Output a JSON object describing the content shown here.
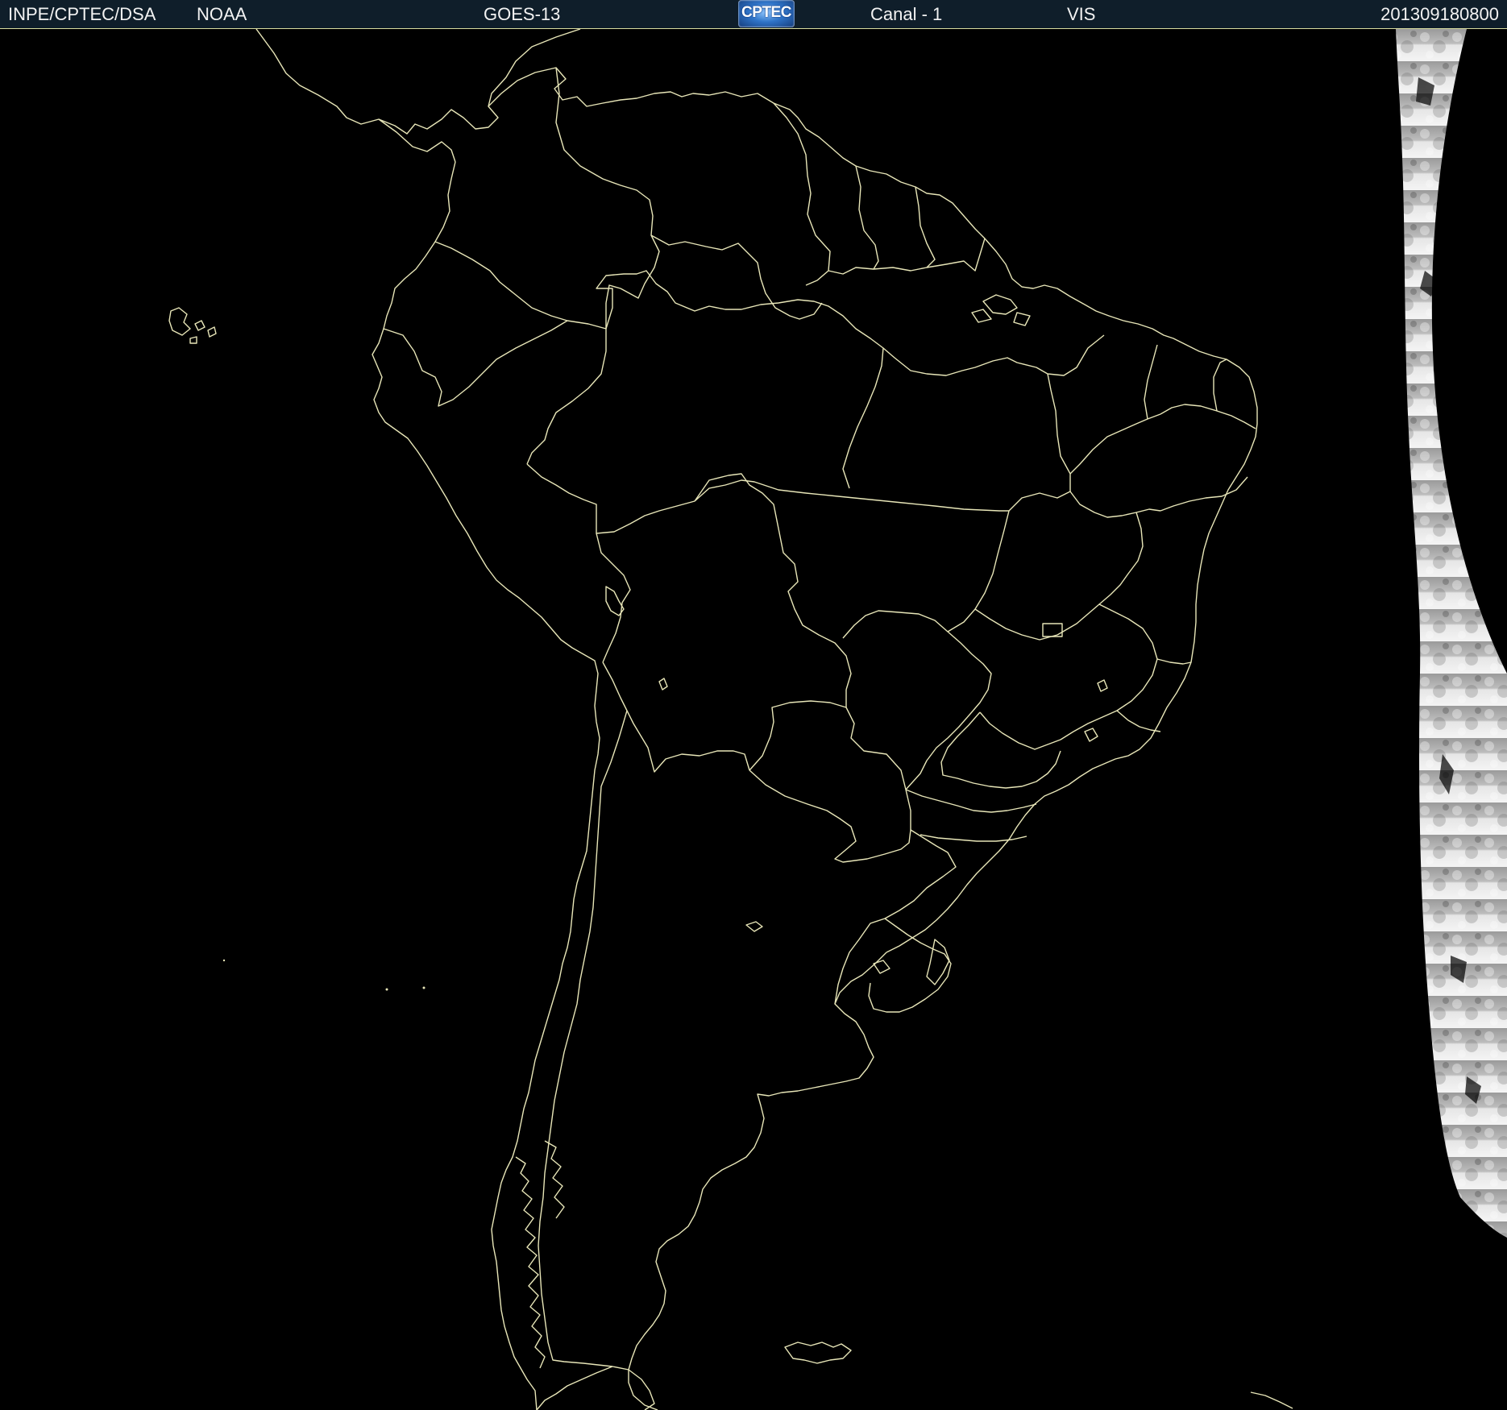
{
  "header": {
    "org": "INPE/CPTEC/DSA",
    "agency": "NOAA",
    "satellite": "GOES-13",
    "logo_text": "CPTEC",
    "channel": "Canal - 1",
    "band": "VIS",
    "timestamp": "201309180800"
  },
  "map": {
    "region": "South America",
    "imagery": "visible channel night scan with illuminated strip at east edge",
    "colors": {
      "background": "#000000",
      "borders": "#e8e6b8",
      "header_bg": "#0f1e2a",
      "cloud_light": "#d9d9d9",
      "cloud_dark": "#8a8a8a"
    }
  }
}
